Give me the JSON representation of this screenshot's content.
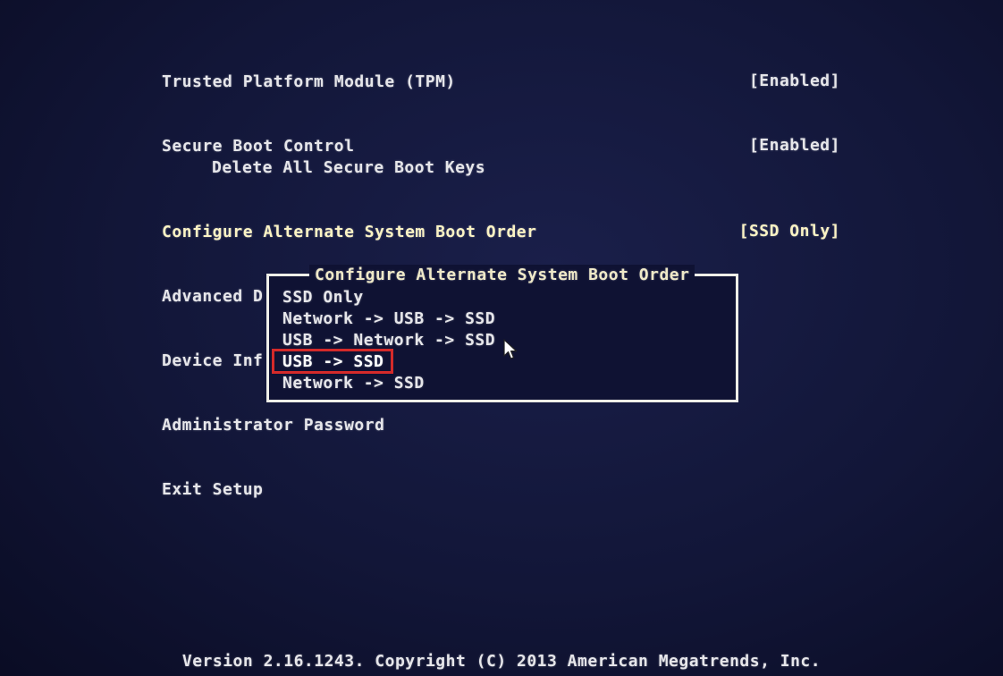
{
  "menu": {
    "tpm": {
      "label": "Trusted Platform Module (TPM)",
      "value": "[Enabled]"
    },
    "secure_boot": {
      "label": "Secure Boot Control",
      "value": "[Enabled]"
    },
    "delete_keys": {
      "label": "Delete All Secure Boot Keys"
    },
    "alt_boot": {
      "label": "Configure Alternate System Boot Order",
      "value": "[SSD Only]"
    },
    "advanced": {
      "label": "Advanced D"
    },
    "device_info": {
      "label": "Device Inf"
    },
    "admin_password": {
      "label": "Administrator Password"
    },
    "exit_setup": {
      "label": "Exit Setup"
    }
  },
  "popup": {
    "title": "Configure Alternate System Boot Order",
    "options": [
      "SSD Only",
      "Network -> USB -> SSD",
      "USB -> Network -> SSD",
      "USB -> SSD",
      "Network -> SSD"
    ],
    "selected_index": 3
  },
  "footer": {
    "text": "Version 2.16.1243. Copyright (C) 2013 American Megatrends, Inc."
  },
  "colors": {
    "background": "#121638",
    "text": "#e6e6ea",
    "highlight_box": "#d42a2a"
  },
  "icons": {
    "cursor": "mouse-pointer-icon"
  }
}
